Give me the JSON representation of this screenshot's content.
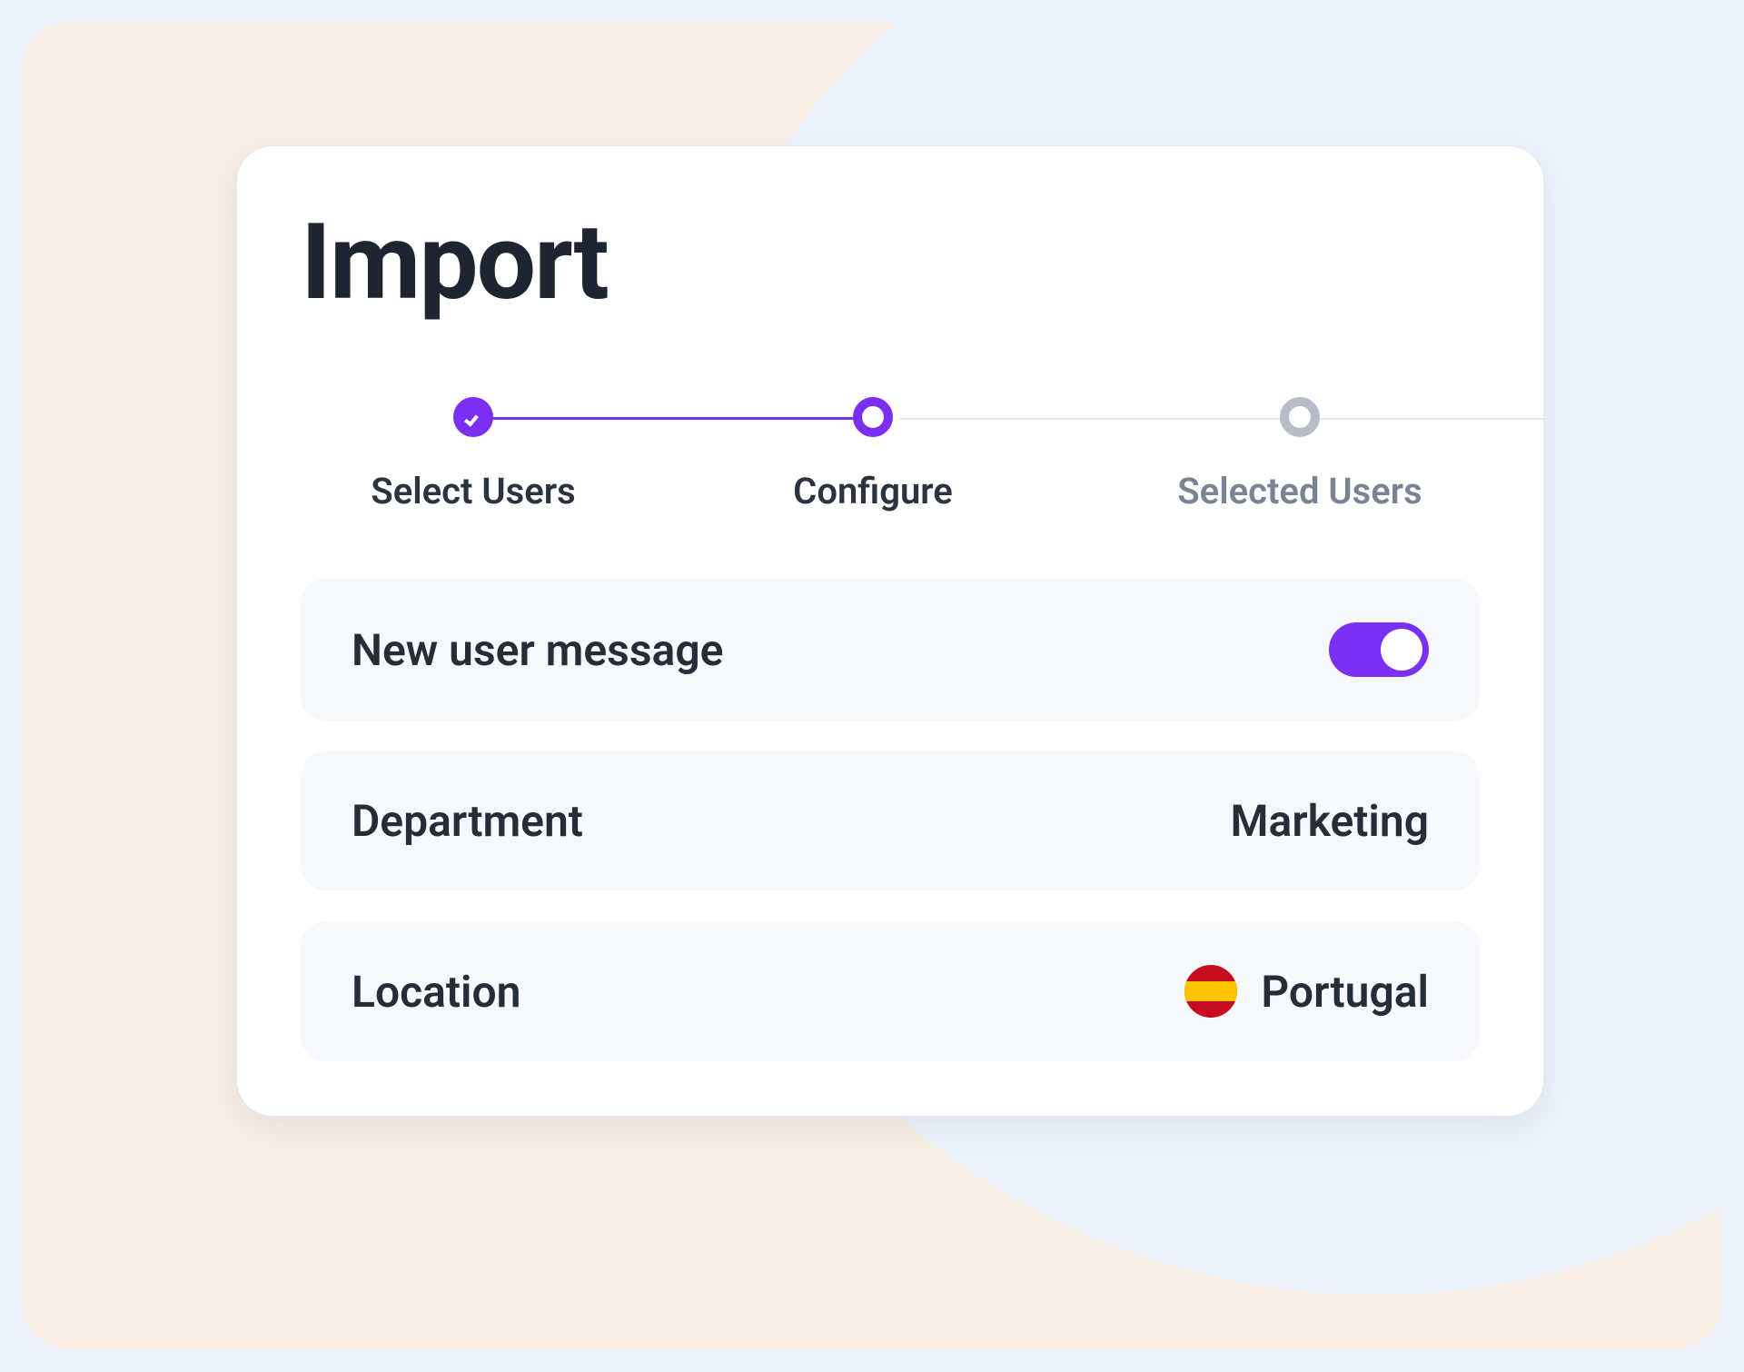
{
  "title": "Import",
  "stepper": {
    "steps": [
      {
        "label": "Select Users",
        "state": "done"
      },
      {
        "label": "Configure",
        "state": "current"
      },
      {
        "label": "Selected Users",
        "state": "future"
      }
    ]
  },
  "settings": {
    "new_user_message": {
      "label": "New user message",
      "enabled": true
    },
    "department": {
      "label": "Department",
      "value": "Marketing"
    },
    "location": {
      "label": "Location",
      "value": "Portugal",
      "flag": "es"
    }
  },
  "colors": {
    "accent": "#7b2ff2",
    "text": "#262c38",
    "muted": "#7a8294",
    "panel": "#f7f8fb"
  }
}
